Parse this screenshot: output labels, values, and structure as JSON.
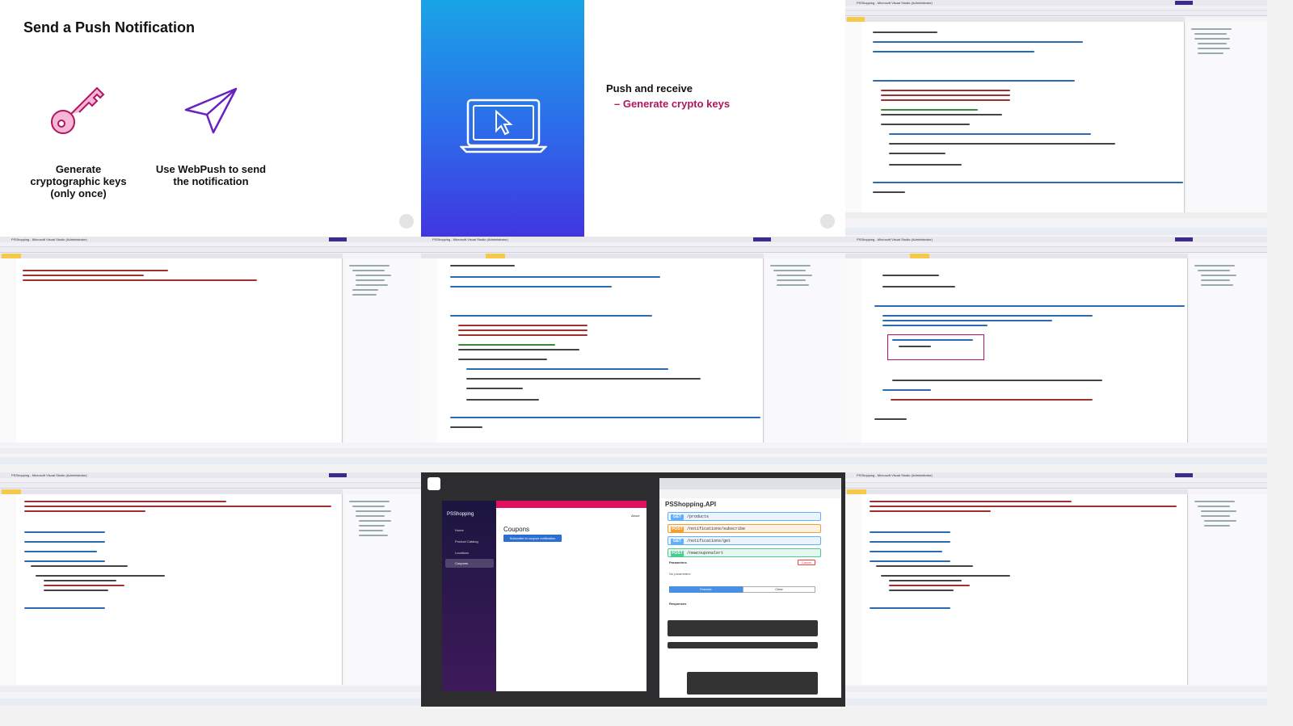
{
  "slide1": {
    "title": "Send a Push Notification",
    "caption_left": "Generate cryptographic keys (only once)",
    "caption_right": "Use WebPush to send the notification",
    "icon_left": "key-icon",
    "icon_right": "paper-plane-icon"
  },
  "slide2": {
    "icon": "laptop-cursor-icon"
  },
  "slide3": {
    "heading": "Push and receive",
    "bullet": "Generate crypto keys"
  },
  "vs": {
    "window_title": "PSShopping - Microsoft Visual Studio (Administrator)",
    "solution_title": "Solution Explorer"
  },
  "browser": {
    "app_brand": "PSShopping",
    "app_heading": "Coupons",
    "subscribe_button": "Subscribe to coupon notification",
    "nav": [
      "Home",
      "Product Catalog",
      "Locations",
      "Coupons"
    ],
    "about_link": "About",
    "swagger_title": "PSShopping.API",
    "ops": [
      {
        "method": "GET",
        "path": "/products"
      },
      {
        "method": "POST",
        "path": "/notifications/subscribe"
      },
      {
        "method": "GET",
        "path": "/notifications/get"
      },
      {
        "method": "POST",
        "path": "/newcouponalert"
      }
    ],
    "params_label": "Parameters",
    "no_params": "No parameters",
    "cancel_label": "Cancel",
    "execute_label": "Execute",
    "clear_label": "Clear",
    "responses_label": "Responses"
  },
  "colors": {
    "accent": "#b0155f",
    "brand_pink": "#e0105f",
    "vs_purple": "#3c2b8c",
    "get": "#61affe",
    "post": "#f0a030",
    "post_green": "#49cc90"
  }
}
